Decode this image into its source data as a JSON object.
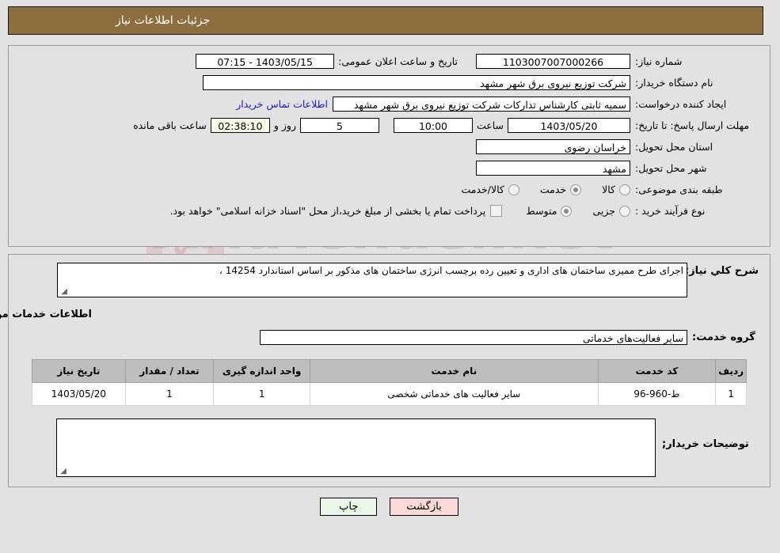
{
  "header": {
    "title": "جزئیات اطلاعات نیاز"
  },
  "form": {
    "need_number_label": "شماره نیاز:",
    "need_number_value": "1103007007000266",
    "announce_datetime_label": "تاریخ و ساعت اعلان عمومی:",
    "announce_datetime_value": "1403/05/15 - 07:15",
    "buyer_org_label": "نام دستگاه خریدار:",
    "buyer_org_value": "شرکت توزیع نیروی برق شهر مشهد",
    "creator_label": "ایجاد کننده درخواست:",
    "creator_value": "سمیه ثابتی کارشناس تدارکات شرکت توزیع نیروی برق شهر مشهد",
    "contact_link": "اطلاعات تماس خریدار",
    "deadline_label": "مهلت ارسال پاسخ: تا تاریخ:",
    "deadline_date": "1403/05/20",
    "deadline_hour_label": "ساعت",
    "deadline_hour_value": "10:00",
    "remaining_days_value": "5",
    "remaining_days_label": "روز و",
    "remaining_time_value": "02:38:10",
    "remaining_time_label": "ساعت باقی مانده",
    "province_label": "استان محل تحویل:",
    "province_value": "خراسان رضوی",
    "city_label": "شهر محل تحویل:",
    "city_value": "مشهد",
    "category_label": "طبقه بندی موضوعی:",
    "category_options": [
      {
        "label": "کالا",
        "selected": false
      },
      {
        "label": "خدمت",
        "selected": true
      },
      {
        "label": "کالا/خدمت",
        "selected": false
      }
    ],
    "process_label": "نوع فرآیند خرید :",
    "process_options": [
      {
        "label": "جزیی",
        "selected": false
      },
      {
        "label": "متوسط",
        "selected": true
      }
    ],
    "treasury_checkbox_label": "پرداخت تمام یا بخشی از مبلغ خرید،از محل \"اسناد خزانه اسلامی\" خواهد بود.",
    "treasury_checked": false
  },
  "description": {
    "label": "شرح کلي نیاز:",
    "value": "اجرای طرح ممیزی ساختمان های اداری و تعیین رده برچسب انرژی ساختمان  های مذکور بر اساس  استاندارد 14254 ،"
  },
  "services": {
    "section_title": "اطلاعات خدمات مورد نیاز",
    "group_label": "گروه خدمت:",
    "group_value": "سایر فعالیت‌های خدماتی",
    "table": {
      "columns": [
        "ردیف",
        "کد خدمت",
        "نام خدمت",
        "واحد اندازه گیری",
        "تعداد / مقدار",
        "تاریخ نیاز"
      ],
      "rows": [
        {
          "radif": "1",
          "code": "ط-960-96",
          "name": "سایر فعالیت های خدماتی شخصی",
          "unit": "1",
          "qty": "1",
          "date": "1403/05/20"
        }
      ]
    }
  },
  "remarks": {
    "label": "توضیحات خریدار;",
    "value": ""
  },
  "footer": {
    "print_label": "چاپ",
    "back_label": "بازگشت"
  },
  "watermark": {
    "text": "AriaTender.net"
  },
  "colors": {
    "header_brown": "#8d6e3f",
    "page_bg": "#e2e2e2",
    "link_blue": "#1919c4",
    "table_header": "#bdbdbd",
    "print_btn": "#e9f7e9",
    "back_btn": "#fbd9d9",
    "countdown_bg": "#fbfbe8"
  }
}
